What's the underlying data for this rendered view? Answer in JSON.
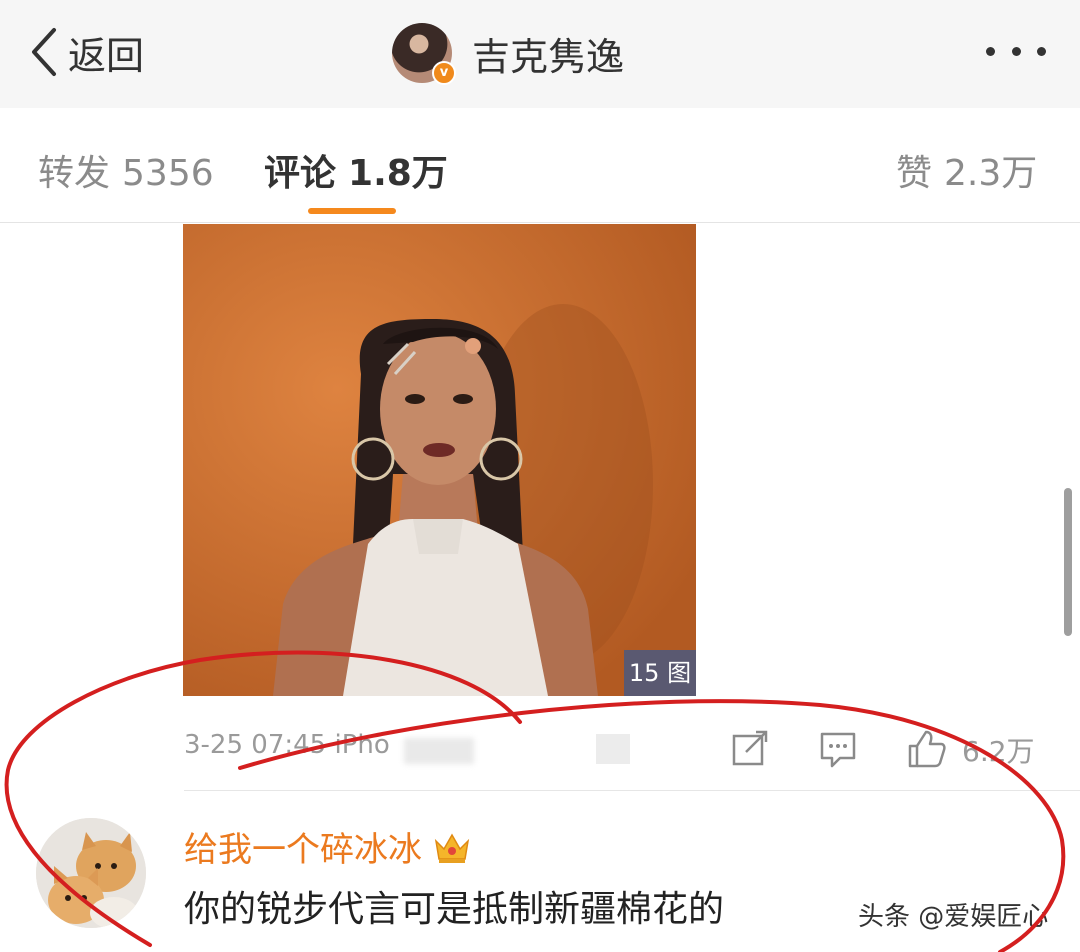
{
  "nav": {
    "back_label": "返回",
    "title": "吉克隽逸",
    "verified_badge": "v"
  },
  "tabs": [
    {
      "label": "转发",
      "count": "5356"
    },
    {
      "label": "评论",
      "count": "1.8万"
    },
    {
      "label": "赞",
      "count": "2.3万"
    }
  ],
  "post": {
    "image_count_badge": "15 图",
    "timestamp": "3-25 07:45  iPho",
    "like_count": "6.2万"
  },
  "comment": {
    "username": "给我一个碎冰冰",
    "text": "你的锐步代言可是抵制新疆棉花的"
  },
  "watermark": "头条 @爱娱匠心",
  "colors": {
    "accent": "#f5891d",
    "username": "#eb7a1f",
    "annotation": "#d41f1f",
    "photo_background": "#d07030"
  }
}
